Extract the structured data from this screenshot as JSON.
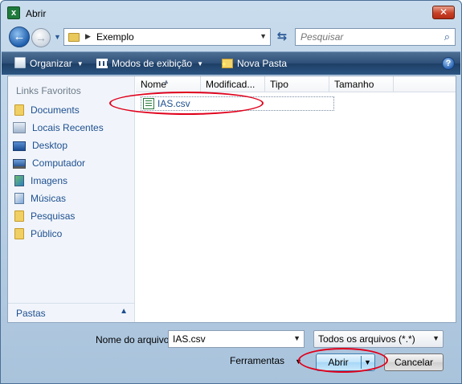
{
  "window": {
    "title": "Abrir",
    "close_label": "✕"
  },
  "address": {
    "crumb": "Exemplo",
    "search_placeholder": "Pesquisar"
  },
  "toolbar": {
    "organize": "Organizar",
    "views": "Modos de exibição",
    "new_folder": "Nova Pasta",
    "help": "?"
  },
  "sidebar": {
    "heading": "Links Favoritos",
    "items": [
      {
        "label": "Documents",
        "icon": "folder-icon"
      },
      {
        "label": "Locais Recentes",
        "icon": "recent-places-icon"
      },
      {
        "label": "Desktop",
        "icon": "desktop-icon"
      },
      {
        "label": "Computador",
        "icon": "computer-icon"
      },
      {
        "label": "Imagens",
        "icon": "pictures-icon"
      },
      {
        "label": "Músicas",
        "icon": "music-icon"
      },
      {
        "label": "Pesquisas",
        "icon": "folder-icon"
      },
      {
        "label": "Público",
        "icon": "folder-icon"
      }
    ],
    "folders_label": "Pastas"
  },
  "filelist": {
    "columns": [
      "Nome",
      "Modificad...",
      "Tipo",
      "Tamanho"
    ],
    "files": [
      {
        "name": "IAS.csv",
        "icon": "csv-file-icon"
      }
    ]
  },
  "footer": {
    "filename_label": "Nome do arquivo:",
    "filename_value": "IAS.csv",
    "filetype": "Todos os arquivos (*.*)",
    "tools": "Ferramentas",
    "open": "Abrir",
    "cancel": "Cancelar"
  },
  "colors": {
    "link": "#1e4f8f",
    "annotation": "#e0001b",
    "toolbar": "#2d4f78"
  }
}
